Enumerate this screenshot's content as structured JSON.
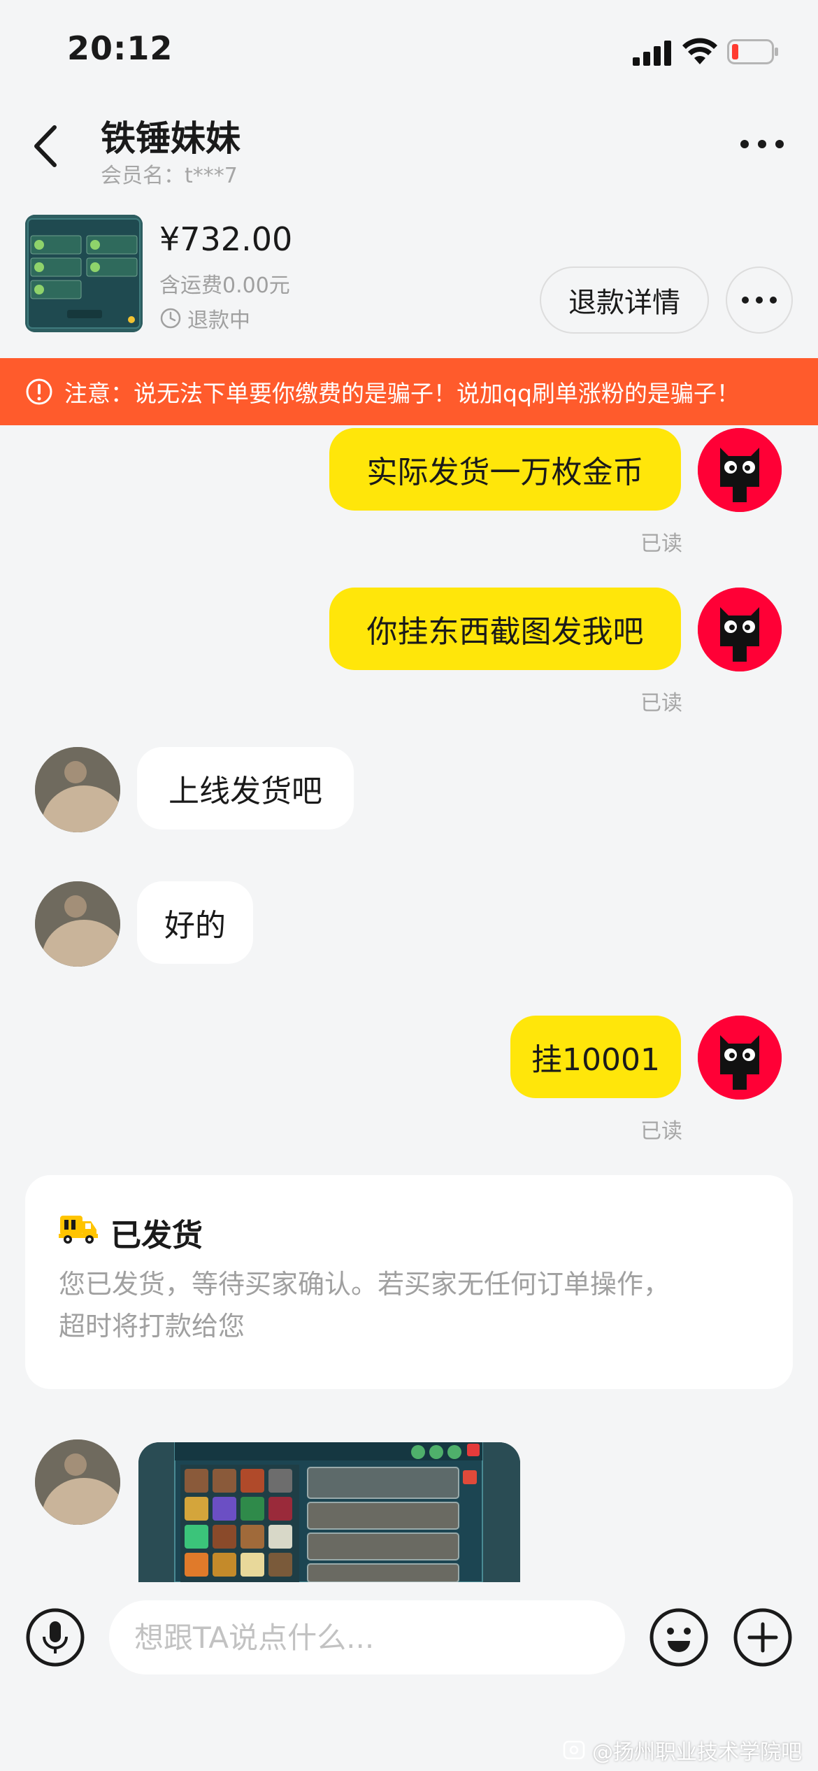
{
  "status_bar": {
    "time": "20:12"
  },
  "header": {
    "name": "铁锤妹妹",
    "member": "会员名：t***7"
  },
  "product": {
    "price": "¥732.00",
    "shipping": "含运费0.00元",
    "status": "退款中",
    "refund_button": "退款详情"
  },
  "warning": "注意：说无法下单要你缴费的是骗子！说加qq刷单涨粉的是骗子！",
  "messages": {
    "m1": {
      "text": "实际发货一万枚金币",
      "read": "已读"
    },
    "m2": {
      "text": "你挂东西截图发我吧",
      "read": "已读"
    },
    "m3": {
      "text": "上线发货吧"
    },
    "m4": {
      "text": "好的"
    },
    "m5": {
      "text": "挂10001",
      "read": "已读"
    }
  },
  "shipped": {
    "title": "已发货",
    "line1": "您已发货，等待买家确认。若买家无任何订单操作，",
    "line2": "超时将打款给您"
  },
  "input": {
    "placeholder": "想跟TA说点什么..."
  },
  "watermark": "@扬州职业技术学院吧",
  "colors": {
    "accent_yellow": "#ffe60a",
    "warning_orange": "#ff5b2c",
    "tmall_red": "#ff0036"
  }
}
